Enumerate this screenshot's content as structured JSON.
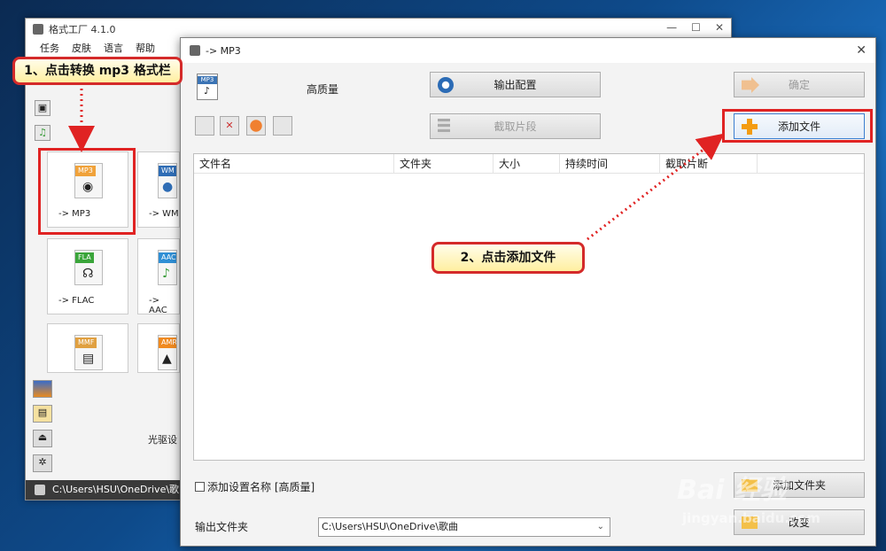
{
  "back_window": {
    "title": "格式工厂 4.1.0",
    "menu": [
      "任务",
      "皮肤",
      "语言",
      "帮助"
    ],
    "tiles": [
      {
        "label": "-> MP3",
        "badge": "MP3",
        "badge_color": "#f0a23a"
      },
      {
        "label": "-> WM",
        "badge": "WM",
        "badge_color": "#2f6db5"
      },
      {
        "label": "-> FLAC",
        "badge": "FLA",
        "badge_color": "#3aa53a"
      },
      {
        "label": "-> AAC",
        "badge": "AAC",
        "badge_color": "#2f8fd5"
      },
      {
        "label": "",
        "badge": "MMF",
        "badge_color": "#e0a040"
      },
      {
        "label": "",
        "badge": "AMR",
        "badge_color": "#f08a20"
      }
    ],
    "side_text": "光驱设",
    "status_path": "C:\\Users\\HSU\\OneDrive\\歌曲"
  },
  "dialog": {
    "title": "-> MP3",
    "preset": "高质量",
    "output_config": "输出配置",
    "ok": "确定",
    "clip": "截取片段",
    "add_file": "添加文件",
    "columns": [
      "文件名",
      "文件夹",
      "大小",
      "持续时间",
      "截取片断"
    ],
    "add_setting_label": "添加设置名称 [高质量]",
    "add_folder": "添加文件夹",
    "change": "改变",
    "output_folder_label": "输出文件夹",
    "output_folder_value": "C:\\Users\\HSU\\OneDrive\\歌曲"
  },
  "callouts": {
    "step1": "1、点击转换 mp3 格式栏",
    "step2": "2、点击添加文件"
  },
  "watermark": {
    "brand": "Bai 经验",
    "url": "jingyan.baidu.com"
  }
}
